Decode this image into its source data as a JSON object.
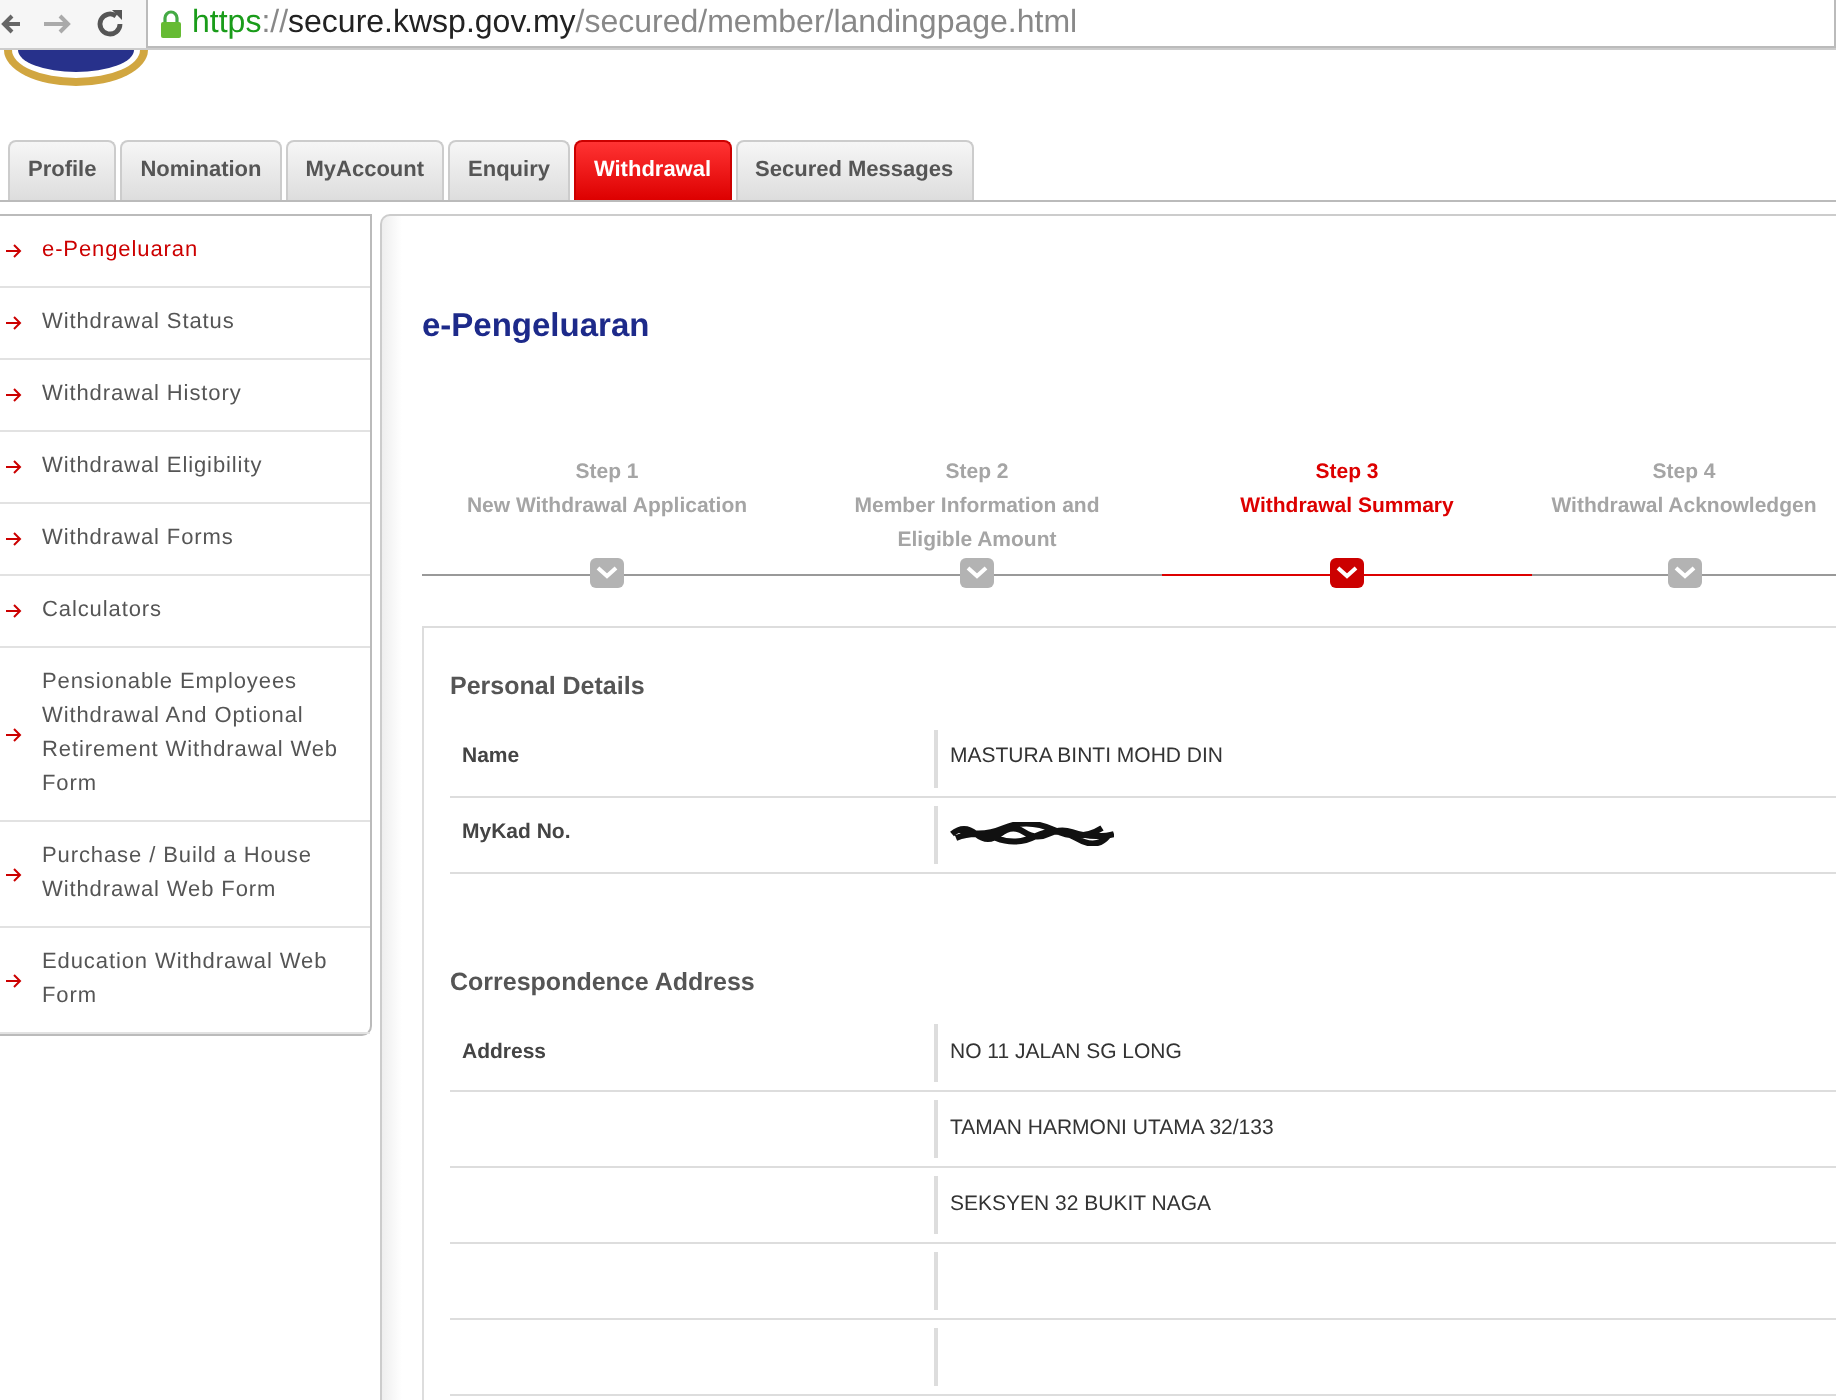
{
  "browser": {
    "scheme": "https",
    "separator": "://",
    "host": "secure.kwsp.gov.my",
    "path": "/secured/member/landingpage.html"
  },
  "tabs": [
    {
      "label": "Profile",
      "selected": false
    },
    {
      "label": "Nomination",
      "selected": false
    },
    {
      "label": "MyAccount",
      "selected": false
    },
    {
      "label": "Enquiry",
      "selected": false
    },
    {
      "label": "Withdrawal",
      "selected": true
    },
    {
      "label": "Secured Messages",
      "selected": false
    }
  ],
  "sidebar": {
    "items": [
      {
        "label": "e-Pengeluaran",
        "selected": true
      },
      {
        "label": "Withdrawal Status",
        "selected": false
      },
      {
        "label": "Withdrawal History",
        "selected": false
      },
      {
        "label": "Withdrawal Eligibility",
        "selected": false
      },
      {
        "label": "Withdrawal Forms",
        "selected": false
      },
      {
        "label": "Calculators",
        "selected": false
      },
      {
        "label": "Pensionable Employees Withdrawal And Optional Retirement Withdrawal Web Form",
        "selected": false
      },
      {
        "label": "Purchase / Build a House Withdrawal Web Form",
        "selected": false
      },
      {
        "label": "Education Withdrawal Web Form",
        "selected": false
      }
    ]
  },
  "page_title": "e-Pengeluaran",
  "steps": [
    {
      "number": "Step 1",
      "label": "New Withdrawal Application",
      "selected": false
    },
    {
      "number": "Step 2",
      "label": "Member Information and Eligible Amount",
      "selected": false
    },
    {
      "number": "Step 3",
      "label": "Withdrawal Summary",
      "selected": true
    },
    {
      "number": "Step 4",
      "label": "Withdrawal Acknowledgen",
      "selected": false
    }
  ],
  "sections": [
    {
      "title": "Personal Details",
      "rows": [
        {
          "kind": "text",
          "label": "Name",
          "value": "MASTURA BINTI MOHD DIN"
        },
        {
          "kind": "redacted",
          "label": "MyKad No."
        }
      ]
    },
    {
      "title": "Correspondence Address",
      "rows": [
        {
          "kind": "text",
          "label": "Address",
          "value": "NO 11 JALAN SG LONG"
        },
        {
          "kind": "text",
          "value": "TAMAN HARMONI UTAMA 32/133"
        },
        {
          "kind": "text",
          "value": "SEKSYEN 32 BUKIT NAGA"
        },
        {
          "kind": "text"
        },
        {
          "kind": "text"
        }
      ]
    }
  ]
}
